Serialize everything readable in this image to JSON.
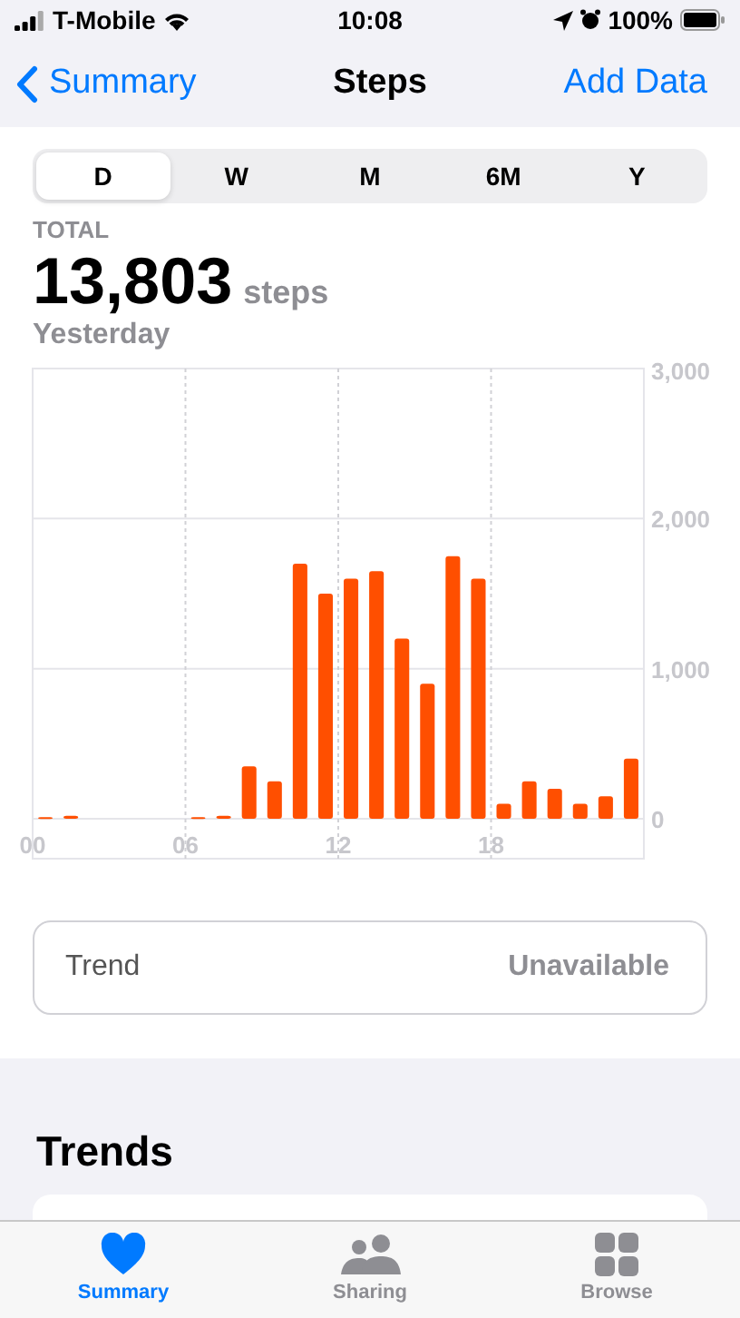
{
  "status_bar": {
    "carrier": "T-Mobile",
    "time": "10:08",
    "battery": "100%"
  },
  "nav": {
    "back": "Summary",
    "title": "Steps",
    "action": "Add Data"
  },
  "segments": [
    {
      "label": "D",
      "selected": true
    },
    {
      "label": "W",
      "selected": false
    },
    {
      "label": "M",
      "selected": false
    },
    {
      "label": "6M",
      "selected": false
    },
    {
      "label": "Y",
      "selected": false
    }
  ],
  "summary": {
    "label": "TOTAL",
    "value": "13,803",
    "unit": "steps",
    "date": "Yesterday"
  },
  "chart_data": {
    "type": "bar",
    "x": [
      0.5,
      1.5,
      6.5,
      7.5,
      8.5,
      9.5,
      10.5,
      11.5,
      12.5,
      13.5,
      14.5,
      15.5,
      16.5,
      17.5,
      18.5,
      19.5,
      20.5,
      21.5,
      22.5,
      23.5
    ],
    "xlim": [
      0,
      24
    ],
    "grid": true,
    "series": [
      {
        "color": "#ff4f00",
        "values": [
          10,
          20,
          10,
          20,
          350,
          250,
          1700,
          1500,
          1600,
          1650,
          1200,
          900,
          1750,
          1600,
          100,
          250,
          200,
          100,
          150,
          400
        ]
      }
    ],
    "ylim": [
      0,
      3000
    ],
    "yticks": [
      {
        "value": 0,
        "label": "0"
      },
      {
        "value": 1000,
        "label": "1,000"
      },
      {
        "value": 2000,
        "label": "2,000"
      },
      {
        "value": 3000,
        "label": "3,000"
      }
    ],
    "xticks": [
      {
        "value": 0,
        "label": "00"
      },
      {
        "value": 6,
        "label": "06"
      },
      {
        "value": 12,
        "label": "12"
      },
      {
        "value": 18,
        "label": "18"
      }
    ]
  },
  "trend": {
    "label": "Trend",
    "value": "Unavailable"
  },
  "trends_heading": "Trends",
  "tab_bar": [
    {
      "label": "Summary",
      "kind": "heart",
      "selected": true
    },
    {
      "label": "Sharing",
      "kind": "people",
      "selected": false
    },
    {
      "label": "Browse",
      "kind": "grid",
      "selected": false
    }
  ]
}
